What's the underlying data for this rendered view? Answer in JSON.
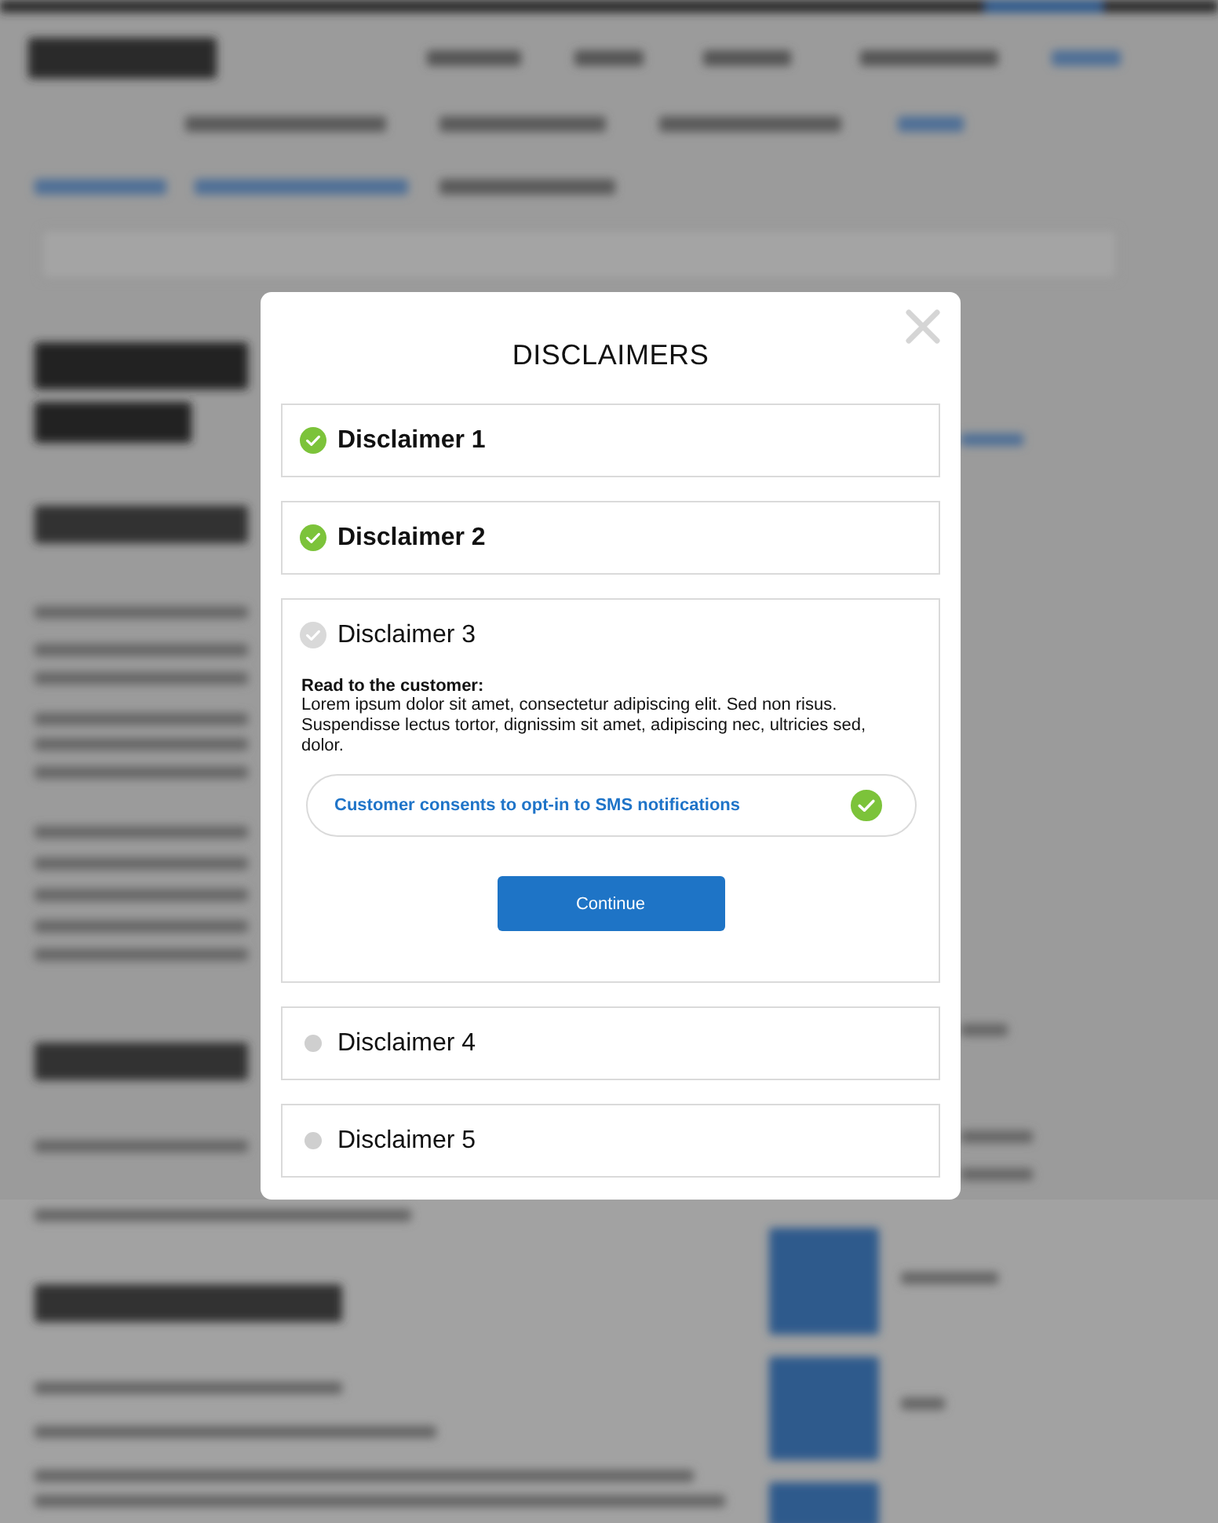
{
  "modal": {
    "title": "DISCLAIMERS",
    "disclaimers": [
      {
        "title": "Disclaimer 1",
        "completed": true,
        "expanded": false
      },
      {
        "title": "Disclaimer 2",
        "completed": true,
        "expanded": false
      },
      {
        "title": "Disclaimer 3",
        "completed": false,
        "expanded": true,
        "heading": "Read to the customer:",
        "body": "Lorem ipsum dolor sit amet, consectetur adipiscing elit. Sed non risus. Suspendisse lectus tortor, dignissim sit amet, adipiscing nec, ultricies sed, dolor.",
        "consent": {
          "label": "Customer consents to opt-in to SMS notifications",
          "checked": true
        },
        "button": "Continue"
      },
      {
        "title": "Disclaimer 4",
        "completed": false,
        "expanded": false
      },
      {
        "title": "Disclaimer 5",
        "completed": false,
        "expanded": false
      }
    ]
  }
}
